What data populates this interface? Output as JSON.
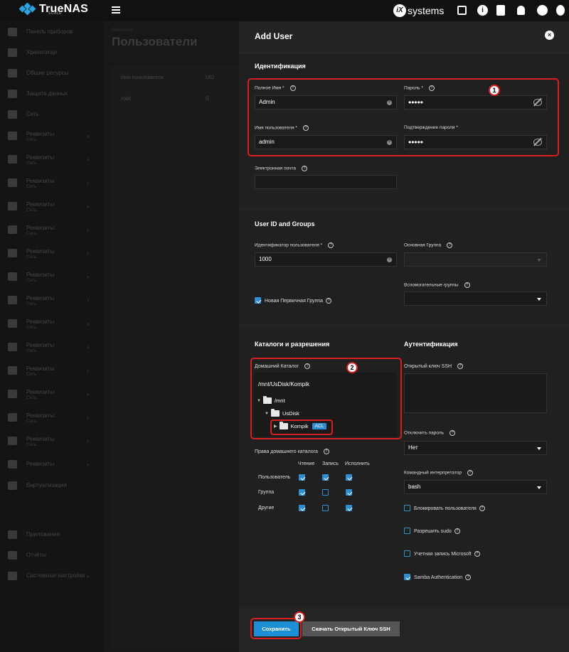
{
  "topbar": {
    "brand": "TrueNAS",
    "brand_sub": "SCALE",
    "vendor_mark": "iX",
    "vendor": "systems"
  },
  "colors": {
    "accent": "#1d8fd6",
    "highlight": "#d81f1f"
  },
  "sidebar": {
    "items": [
      {
        "label": "Панель приборов",
        "icon": "dashboard-icon"
      },
      {
        "label": "Хранилище",
        "icon": "storage-icon"
      },
      {
        "label": "Общие ресурсы",
        "icon": "shares-icon"
      },
      {
        "label": "Защита данных",
        "icon": "shield-icon"
      },
      {
        "label": "Сеть",
        "icon": "network-icon"
      },
      {
        "label": "Реквизиты",
        "sub": "Сеть",
        "icon": "key-icon"
      },
      {
        "label": "Реквизиты",
        "sub": "Сеть",
        "icon": "key-icon"
      },
      {
        "label": "Реквизиты",
        "sub": "Сеть",
        "icon": "key-icon"
      },
      {
        "label": "Реквизиты",
        "sub": "Сеть",
        "icon": "key-icon"
      },
      {
        "label": "Реквизиты",
        "sub": "Сеть",
        "icon": "key-icon"
      },
      {
        "label": "Реквизиты",
        "sub": "Сеть",
        "icon": "key-icon"
      },
      {
        "label": "Реквизиты",
        "sub": "Сеть",
        "icon": "key-icon"
      },
      {
        "label": "Реквизиты",
        "sub": "Сеть",
        "icon": "key-icon"
      },
      {
        "label": "Реквизиты",
        "sub": "Сеть",
        "icon": "key-icon"
      },
      {
        "label": "Реквизиты",
        "sub": "Сеть",
        "icon": "key-icon"
      },
      {
        "label": "Реквизиты",
        "sub": "Сеть",
        "icon": "key-icon"
      },
      {
        "label": "Реквизиты",
        "sub": "Сеть",
        "icon": "key-icon"
      },
      {
        "label": "Реквизиты",
        "sub": "Сеть",
        "icon": "key-icon"
      },
      {
        "label": "Реквизиты",
        "sub": "Сеть",
        "icon": "key-icon"
      },
      {
        "label": "Реквизиты",
        "icon": "key-icon"
      },
      {
        "label": "Виртуализация",
        "icon": "vm-icon"
      },
      {
        "label": "Приложения",
        "icon": "apps-icon"
      },
      {
        "label": "Отчёты",
        "icon": "reports-icon"
      },
      {
        "label": "Системные настройки",
        "icon": "settings-icon"
      }
    ]
  },
  "page": {
    "breadcrumb": "Реквизиты",
    "title": "Пользователи"
  },
  "table": {
    "headers": [
      "Имя пользователя",
      "UID"
    ],
    "rows": [
      [
        "root",
        "0"
      ]
    ]
  },
  "panel": {
    "title": "Add User",
    "identification": {
      "title": "Идентификация",
      "full_name_label": "Полное Имя *",
      "full_name_value": "Admin",
      "password_label": "Пароль *",
      "password_value": "•••••",
      "username_label": "Имя пользователя *",
      "username_value": "admin",
      "confirm_label": "Подтверждение пароля *",
      "confirm_value": "•••••",
      "email_label": "Электронная почта",
      "email_value": ""
    },
    "ids_groups": {
      "title": "User ID and Groups",
      "uid_label": "Идентификатор пользователя *",
      "uid_value": "1000",
      "primary_group_label": "Основная Группа",
      "aux_groups_label": "Вспомогательные группы",
      "new_primary_group_label": "Новая Первичная Группа"
    },
    "dirs": {
      "title": "Каталоги и разрешения",
      "home_label": "Домашний Каталог",
      "home_value": "/mnt/UsDisk/Kompik",
      "tree": [
        "/mnt",
        "UsDisk",
        "Kompik"
      ],
      "acl": "ACL",
      "perm_label": "Права домашнего каталога",
      "perm_cols": [
        "Чтение",
        "Запись",
        "Исполнить"
      ],
      "perm_rows": [
        "Пользователь",
        "Группа",
        "Другие"
      ]
    },
    "auth": {
      "title": "Аутентификация",
      "ssh_label": "Открытый ключ SSH",
      "disable_pw_label": "Отключить пароль",
      "disable_pw_value": "Нет",
      "shell_label": "Командный интерпретатор",
      "shell_value": "bash",
      "lock_label": "Блокировать пользователя",
      "sudo_label": "Разрешить sudo",
      "ms_label": "Учетная запись Microsoft",
      "samba_label": "Samba Authentication"
    },
    "buttons": {
      "save": "Сохранить",
      "ssh": "Скачать Открытый Ключ SSH"
    },
    "markers": [
      "1",
      "2",
      "3"
    ]
  }
}
